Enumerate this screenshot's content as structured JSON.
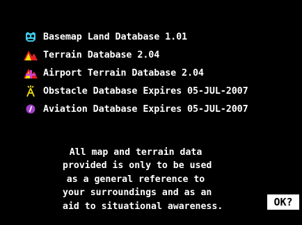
{
  "databases": [
    {
      "icon": "basemap-mask-icon",
      "label": "Basemap Land Database 1.01"
    },
    {
      "icon": "terrain-mountain-icon",
      "label": "Terrain Database 2.04"
    },
    {
      "icon": "airport-terrain-icon",
      "label": "Airport Terrain Database 2.04"
    },
    {
      "icon": "obstacle-tower-icon",
      "label": "Obstacle Database Expires 05-JUL-2007"
    },
    {
      "icon": "aviation-compass-icon",
      "label": "Aviation Database Expires 05-JUL-2007"
    }
  ],
  "notice_lines": [
    "All map and terrain data",
    "provided is only to be used",
    "as a general reference to",
    "your surroundings and as an",
    "aid to situational awareness."
  ],
  "ok_label": "OK?",
  "colors": {
    "background": "#000000",
    "text": "#ffffff",
    "basemap_icon": "#3fc8e8",
    "terrain_red": "#e02020",
    "terrain_yellow": "#f0e010",
    "airport_magenta": "#d040d0",
    "obstacle_yellow": "#f0e010",
    "aviation_purple": "#a040c8"
  }
}
